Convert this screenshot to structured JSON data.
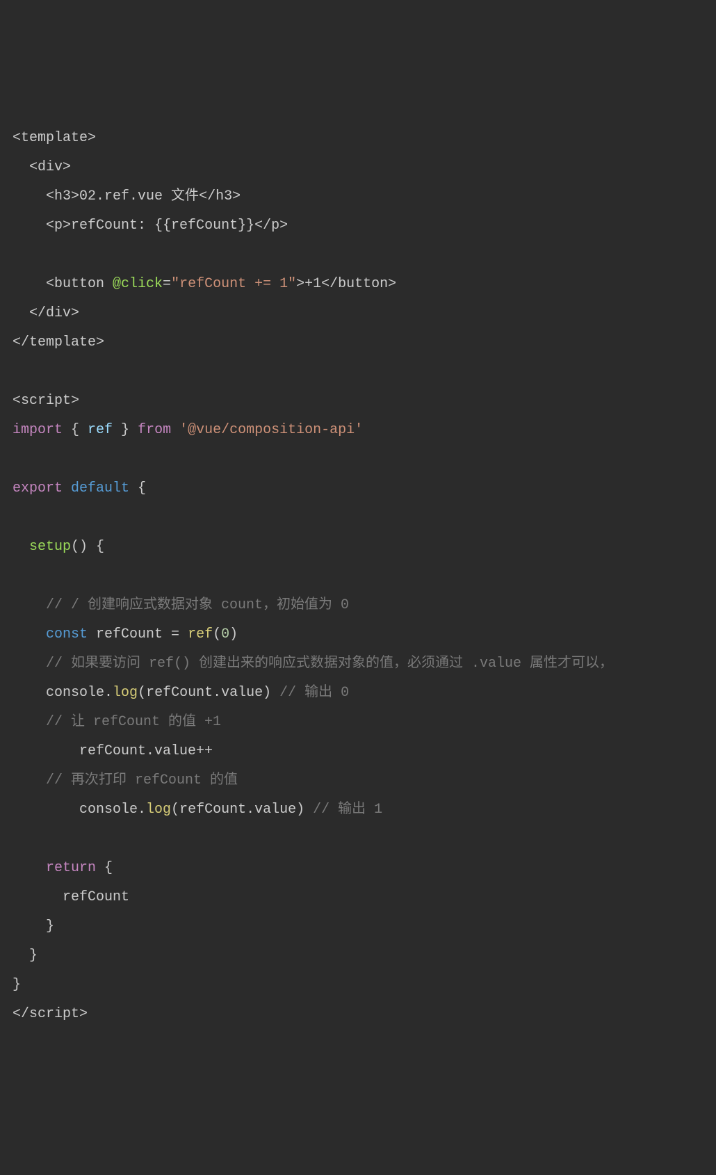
{
  "code": {
    "line1": {
      "open": "<template>"
    },
    "line2": {
      "open": "<div>"
    },
    "line3": {
      "tag_open": "<h3>",
      "text": "02.ref.vue 文件",
      "tag_close": "</h3>"
    },
    "line4": {
      "tag_open": "<p>",
      "text": "refCount: {{refCount}}",
      "tag_close": "</p>"
    },
    "line5": {
      "tag_open": "<button ",
      "attr": "@click",
      "eq": "=",
      "val": "\"refCount += 1\"",
      "close_angle": ">",
      "text": "+1",
      "tag_close": "</button>"
    },
    "line6": {
      "close": "</div>"
    },
    "line7": {
      "close": "</template>"
    },
    "line8": {
      "open": "<script>"
    },
    "line9": {
      "import": "import",
      "brace_o": " { ",
      "name": "ref",
      "brace_c": " } ",
      "from": "from",
      "str": " '@vue/composition-api'"
    },
    "line10": {
      "export": "export",
      "default": " default ",
      "brace": "{"
    },
    "line11": {
      "fn": "setup",
      "paren": "() {"
    },
    "line12": {
      "comment": "// / 创建响应式数据对象 count，初始值为 0"
    },
    "line13": {
      "const": "const ",
      "var": "refCount = ",
      "fn": "ref",
      "paren_o": "(",
      "num": "0",
      "paren_c": ")"
    },
    "line14": {
      "comment": "// 如果要访问 ref() 创建出来的响应式数据对象的值，必须通过 .value 属性才可以，"
    },
    "line15": {
      "obj": "console.",
      "fn": "log",
      "paren_o": "(",
      "arg": "refCount.value",
      "paren_c": ") ",
      "comment": "// 输出 0"
    },
    "line16": {
      "comment": "// 让 refCount 的值 +1"
    },
    "line17": {
      "expr": "refCount.value++"
    },
    "line18": {
      "comment": "// 再次打印 refCount 的值"
    },
    "line19": {
      "obj": "console.",
      "fn": "log",
      "paren_o": "(",
      "arg": "refCount.value",
      "paren_c": ") ",
      "comment": "// 输出 1"
    },
    "line20": {
      "return": "return",
      "brace": " {"
    },
    "line21": {
      "var": "refCount"
    },
    "line22": {
      "brace": "}"
    },
    "line23": {
      "brace": "}"
    },
    "line24": {
      "brace": "}"
    },
    "line25": {
      "close_script": "</script>"
    }
  }
}
